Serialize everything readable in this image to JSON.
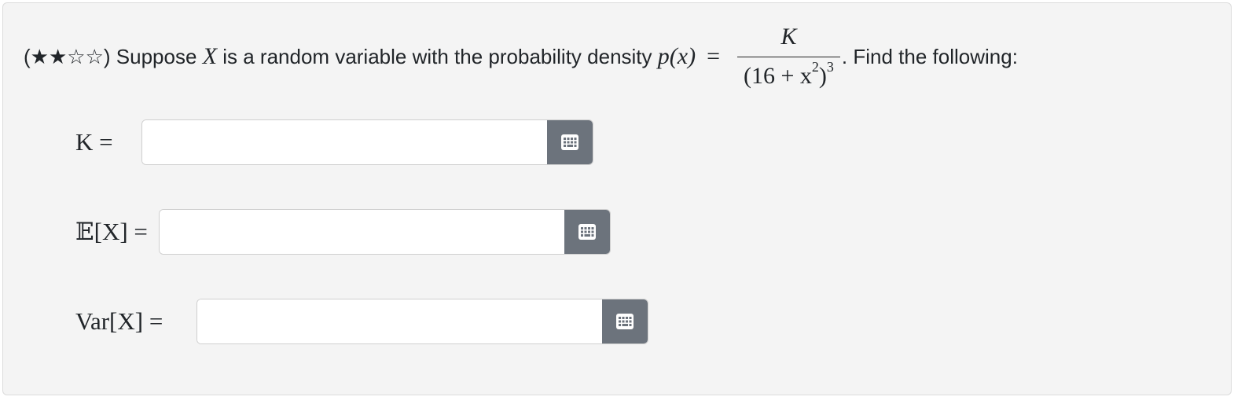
{
  "question": {
    "difficulty_prefix": "(★★☆☆)",
    "text_suppose": "Suppose",
    "var_X": "X",
    "text_middle": "is a random variable with the probability density",
    "density_lhs": "p(x)",
    "equals": "=",
    "fraction_numerator": "K",
    "fraction_denominator_base": "(16 + x",
    "fraction_denominator_inner_exp": "2",
    "fraction_denominator_close": ")",
    "fraction_denominator_outer_exp": "3",
    "text_end": ". Find the following:"
  },
  "answers": [
    {
      "label": "K =",
      "value": "",
      "placeholder": ""
    },
    {
      "label": "𝔼[X] =",
      "value": "",
      "placeholder": ""
    },
    {
      "label": "Var[X] =",
      "value": "",
      "placeholder": ""
    }
  ],
  "icons": {
    "keypad": "keypad-grid-icon"
  },
  "colors": {
    "button": "#6c737c",
    "background": "#f4f4f4"
  }
}
